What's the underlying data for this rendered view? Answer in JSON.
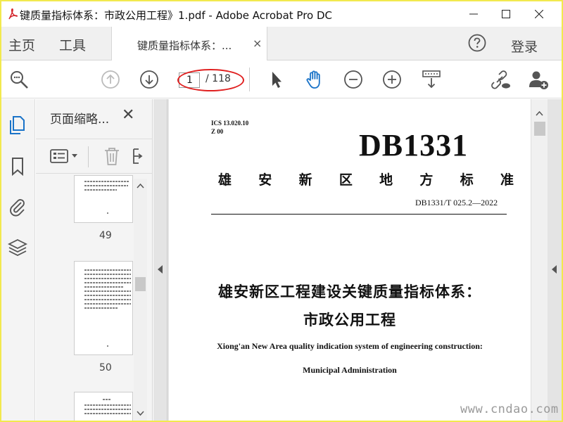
{
  "window": {
    "title": "键质量指标体系：市政公用工程》1.pdf - Adobe Acrobat Pro DC"
  },
  "nav": {
    "home": "主页",
    "tools": "工具",
    "doc_tab": "键质量指标体系：...",
    "doc_tab_close": "×",
    "login": "登录"
  },
  "toolbar": {
    "page_current": "1",
    "page_total": "/ 118",
    "icons": [
      "search-zoom-icon",
      "page-up-icon",
      "page-down-icon",
      "select-cursor-icon",
      "hand-tool-icon",
      "zoom-out-icon",
      "zoom-in-icon",
      "scroll-mode-icon",
      "link-share-icon",
      "add-user-icon"
    ]
  },
  "thumbnails": {
    "title": "页面缩略...",
    "close": "✕",
    "pages": [
      "49",
      "50"
    ]
  },
  "document": {
    "ics": "ICS 13.020.10",
    "z": "Z 00",
    "code": "DB1331",
    "standard_chars": [
      "雄",
      "安",
      "新",
      "区",
      "地",
      "方",
      "标",
      "准"
    ],
    "number": "DB1331/T 025.2—2022",
    "title_line1": "雄安新区工程建设关键质量指标体系：",
    "title_line2": "市政公用工程",
    "en_line1": "Xiong'an New Area quality indication system of engineering construction:",
    "en_line2": "Municipal Administration"
  },
  "watermark": "www.cndao.com",
  "colors": {
    "frame_border": "#f2e94e",
    "accent_blue": "#1a73c8",
    "annotation_red": "#e02020"
  }
}
